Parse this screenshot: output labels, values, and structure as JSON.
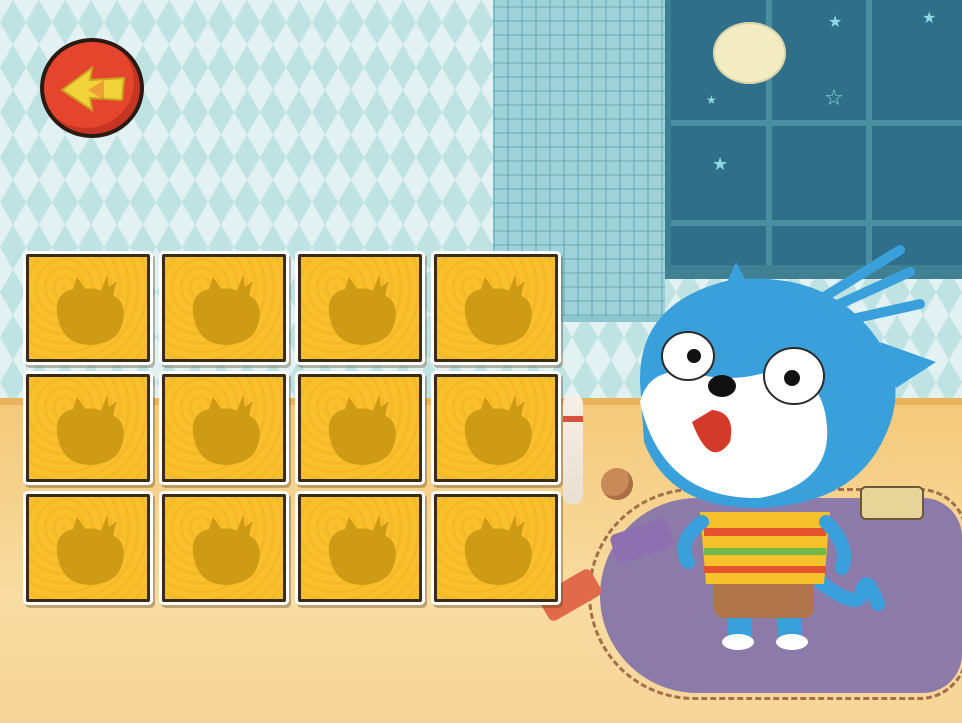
{
  "screen": "memory-card-game",
  "back_button": {
    "icon": "back-arrow-icon"
  },
  "cards": {
    "rows": 3,
    "columns": 4,
    "face": "face-down",
    "back_icon": "cat-silhouette-icon",
    "items": [
      {
        "id": 1
      },
      {
        "id": 2
      },
      {
        "id": 3
      },
      {
        "id": 4
      },
      {
        "id": 5
      },
      {
        "id": 6
      },
      {
        "id": 7
      },
      {
        "id": 8
      },
      {
        "id": 9
      },
      {
        "id": 10
      },
      {
        "id": 11
      },
      {
        "id": 12
      }
    ]
  },
  "character": {
    "icon": "blue-cat-icon"
  },
  "colors": {
    "card_fill": "#f8c02c",
    "card_silhouette": "#cf9a14",
    "back_button": "#e4452c",
    "back_arrow": "#f2d33a",
    "cat_blue": "#3aa0dc",
    "night_window": "#2f6f8a"
  }
}
